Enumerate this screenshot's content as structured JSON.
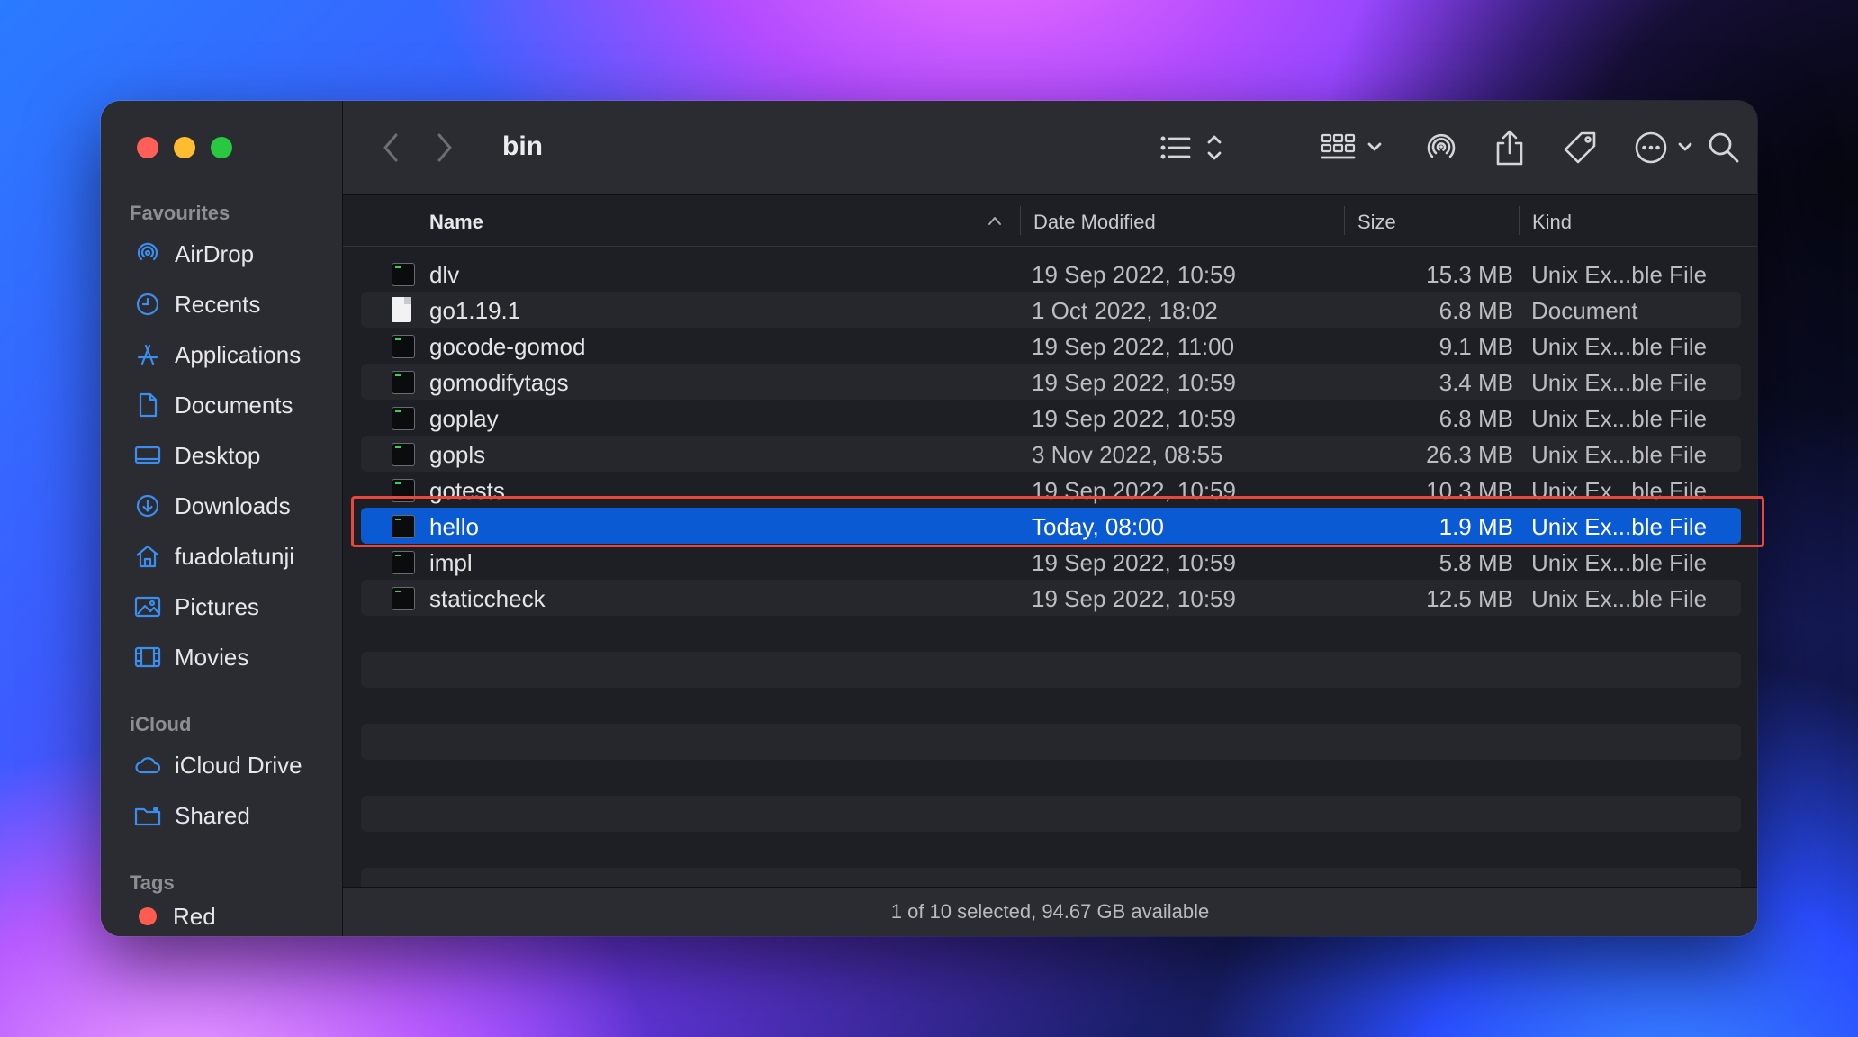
{
  "window": {
    "title": "bin",
    "status_text": "1 of 10 selected, 94.67 GB available"
  },
  "sidebar": {
    "favourites_label": "Favourites",
    "favourites": [
      {
        "label": "AirDrop",
        "icon": "airdrop-icon"
      },
      {
        "label": "Recents",
        "icon": "clock-icon"
      },
      {
        "label": "Applications",
        "icon": "applications-icon"
      },
      {
        "label": "Documents",
        "icon": "document-icon"
      },
      {
        "label": "Desktop",
        "icon": "desktop-icon"
      },
      {
        "label": "Downloads",
        "icon": "download-icon"
      },
      {
        "label": "fuadolatunji",
        "icon": "home-icon"
      },
      {
        "label": "Pictures",
        "icon": "pictures-icon"
      },
      {
        "label": "Movies",
        "icon": "film-icon"
      }
    ],
    "icloud_label": "iCloud",
    "icloud": [
      {
        "label": "iCloud Drive",
        "icon": "cloud-icon"
      },
      {
        "label": "Shared",
        "icon": "shared-folder-icon"
      }
    ],
    "tags_label": "Tags",
    "tags": [
      {
        "label": "Red",
        "color": "#ff5b4f"
      }
    ]
  },
  "columns": {
    "name": "Name",
    "date": "Date Modified",
    "size": "Size",
    "kind": "Kind"
  },
  "files": [
    {
      "name": "dlv",
      "date": "19 Sep 2022, 10:59",
      "size": "15.3 MB",
      "kind": "Unix Ex...ble File",
      "type": "exec"
    },
    {
      "name": "go1.19.1",
      "date": "1 Oct 2022, 18:02",
      "size": "6.8 MB",
      "kind": "Document",
      "type": "doc"
    },
    {
      "name": "gocode-gomod",
      "date": "19 Sep 2022, 11:00",
      "size": "9.1 MB",
      "kind": "Unix Ex...ble File",
      "type": "exec"
    },
    {
      "name": "gomodifytags",
      "date": "19 Sep 2022, 10:59",
      "size": "3.4 MB",
      "kind": "Unix Ex...ble File",
      "type": "exec"
    },
    {
      "name": "goplay",
      "date": "19 Sep 2022, 10:59",
      "size": "6.8 MB",
      "kind": "Unix Ex...ble File",
      "type": "exec"
    },
    {
      "name": "gopls",
      "date": "3 Nov 2022, 08:55",
      "size": "26.3 MB",
      "kind": "Unix Ex...ble File",
      "type": "exec"
    },
    {
      "name": "gotests",
      "date": "19 Sep 2022, 10:59",
      "size": "10.3 MB",
      "kind": "Unix Ex...ble File",
      "type": "exec"
    },
    {
      "name": "hello",
      "date": "Today, 08:00",
      "size": "1.9 MB",
      "kind": "Unix Ex...ble File",
      "type": "exec",
      "selected": true
    },
    {
      "name": "impl",
      "date": "19 Sep 2022, 10:59",
      "size": "5.8 MB",
      "kind": "Unix Ex...ble File",
      "type": "exec"
    },
    {
      "name": "staticcheck",
      "date": "19 Sep 2022, 10:59",
      "size": "12.5 MB",
      "kind": "Unix Ex...ble File",
      "type": "exec"
    }
  ],
  "colors": {
    "selection": "#0a5bd3",
    "highlight_box": "#e8473c",
    "sidebar_icon": "#3b8ef0"
  }
}
